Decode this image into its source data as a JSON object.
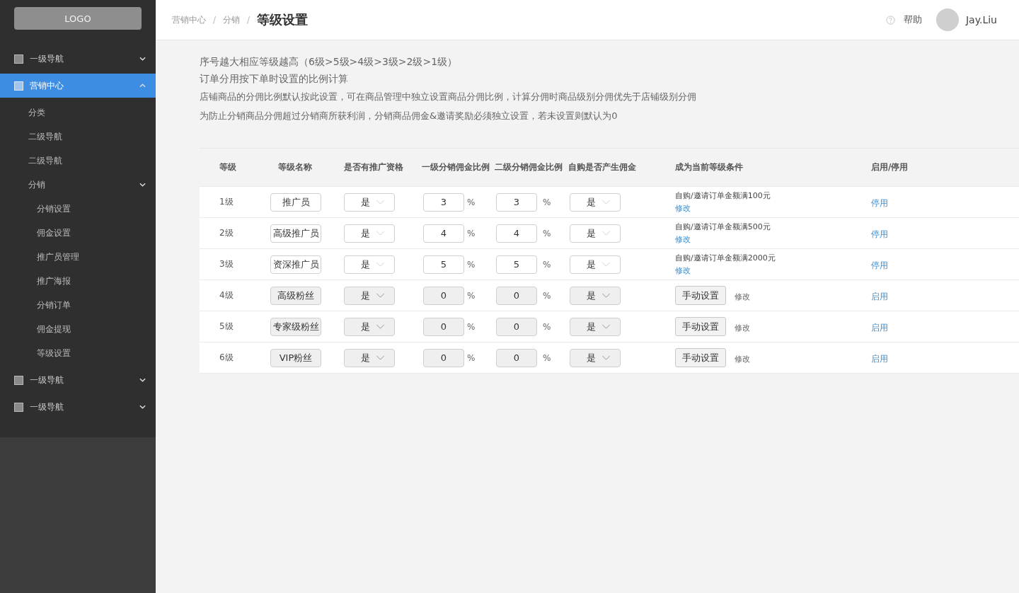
{
  "sidebar": {
    "logo": "LOGO",
    "items": [
      {
        "label": "一级导航",
        "selected": false,
        "expanded": false
      },
      {
        "label": "营销中心",
        "selected": true,
        "expanded": true,
        "children": [
          {
            "label": "分类"
          },
          {
            "label": "二级导航"
          },
          {
            "label": "二级导航"
          },
          {
            "label": "分销",
            "expanded": true,
            "children": [
              {
                "label": "分销设置"
              },
              {
                "label": "佣金设置"
              },
              {
                "label": "推广员管理"
              },
              {
                "label": "推广海报"
              },
              {
                "label": "分销订单"
              },
              {
                "label": "佣金提现"
              },
              {
                "label": "等级设置"
              }
            ]
          }
        ]
      },
      {
        "label": "一级导航",
        "selected": false,
        "expanded": false
      },
      {
        "label": "一级导航",
        "selected": false,
        "expanded": false
      }
    ]
  },
  "breadcrumb": [
    "营销中心",
    "分销"
  ],
  "breadcrumb_separator": "/",
  "page_title": "等级设置",
  "header": {
    "help": "帮助",
    "user": "Jay.Liu"
  },
  "notes": [
    "序号越大相应等级越高（6级>5级>4级>3级>2级>1级）",
    "订单分用按下单时设置的比例计算",
    "店铺商品的分佣比例默认按此设置，可在商品管理中独立设置商品分佣比例，计算分佣时商品级别分佣优先于店铺级别分佣",
    "为防止分销商品分佣超过分销商所获利润，分销商品佣金&邀请奖励必须独立设置，若未设置则默认为0"
  ],
  "table": {
    "columns": [
      "等级",
      "等级名称",
      "是否有推广资格",
      "一级分销佣金比例",
      "二级分销佣金比例",
      "自购是否产生佣金",
      "成为当前等级条件",
      "启用/停用"
    ],
    "percent": "%",
    "rows": [
      {
        "level": "1级",
        "name": "推广员",
        "qualified": "是",
        "rate1": "3",
        "rate2": "3",
        "self_buy": "是",
        "disabled": false,
        "condition": {
          "kind": "text",
          "text": "自购/邀请订单金额满100元",
          "edit": "修改"
        },
        "toggle": "停用"
      },
      {
        "level": "2级",
        "name": "高级推广员",
        "qualified": "是",
        "rate1": "4",
        "rate2": "4",
        "self_buy": "是",
        "disabled": false,
        "condition": {
          "kind": "text",
          "text": "自购/邀请订单金额满500元",
          "edit": "修改"
        },
        "toggle": "停用"
      },
      {
        "level": "3级",
        "name": "资深推广员",
        "qualified": "是",
        "rate1": "5",
        "rate2": "5",
        "self_buy": "是",
        "disabled": false,
        "condition": {
          "kind": "text",
          "text": "自购/邀请订单金额满2000元",
          "edit": "修改"
        },
        "toggle": "停用"
      },
      {
        "level": "4级",
        "name": "高级粉丝",
        "qualified": "是",
        "rate1": "0",
        "rate2": "0",
        "self_buy": "是",
        "disabled": true,
        "condition": {
          "kind": "manual",
          "text": "手动设置",
          "edit": "修改"
        },
        "toggle": "启用"
      },
      {
        "level": "5级",
        "name": "专家级粉丝",
        "qualified": "是",
        "rate1": "0",
        "rate2": "0",
        "self_buy": "是",
        "disabled": true,
        "condition": {
          "kind": "manual",
          "text": "手动设置",
          "edit": "修改"
        },
        "toggle": "启用"
      },
      {
        "level": "6级",
        "name": "VIP粉丝",
        "qualified": "是",
        "rate1": "0",
        "rate2": "0",
        "self_buy": "是",
        "disabled": true,
        "condition": {
          "kind": "manual",
          "text": "手动设置",
          "edit": "修改"
        },
        "toggle": "启用"
      }
    ]
  }
}
